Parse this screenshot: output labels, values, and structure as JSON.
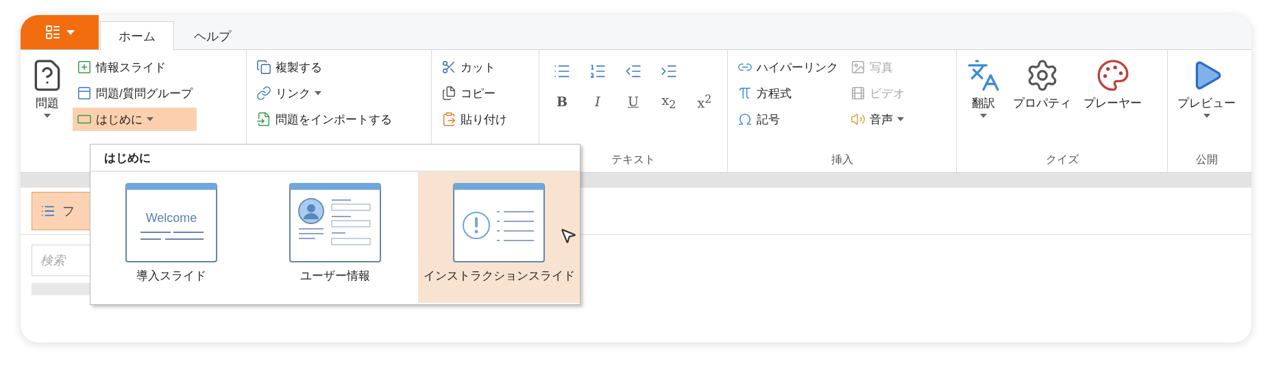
{
  "tabs": [
    {
      "label": "ホーム",
      "selected": true
    },
    {
      "label": "ヘルプ",
      "selected": false
    }
  ],
  "ribbon": {
    "groups": [
      {
        "kind": "buttons",
        "items": [
          {
            "kind": "large",
            "label": "問題",
            "dropdown": true,
            "open": false
          },
          {
            "kind": "small",
            "label": "情報スライド",
            "dropdown": false,
            "open": false
          },
          {
            "kind": "small",
            "label": "問題/質問グループ",
            "dropdown": false,
            "open": false
          },
          {
            "kind": "small",
            "label": "はじめに",
            "dropdown": true,
            "open": true
          }
        ]
      },
      {
        "kind": "buttons",
        "items": [
          {
            "kind": "small",
            "label": "複製する",
            "dropdown": false
          },
          {
            "kind": "small",
            "label": "リンク",
            "dropdown": true
          },
          {
            "kind": "small",
            "label": "問題をインポートする",
            "dropdown": false
          }
        ]
      },
      {
        "kind": "buttons",
        "items": [
          {
            "kind": "small",
            "label": "カット",
            "dropdown": false
          },
          {
            "kind": "small",
            "label": "コピー",
            "dropdown": false
          },
          {
            "kind": "small",
            "label": "貼り付け",
            "dropdown": false
          }
        ]
      },
      {
        "kind": "format",
        "label": "テキスト",
        "rows": [
          [
            {
              "kind": "icon"
            },
            {
              "kind": "icon"
            },
            {
              "kind": "icon"
            },
            {
              "kind": "icon"
            }
          ],
          [
            {
              "kind": "bold",
              "label": "B"
            },
            {
              "kind": "italic",
              "label": "I"
            },
            {
              "kind": "underline",
              "label": "U"
            },
            {
              "kind": "script",
              "label": "x$_{2}$"
            },
            {
              "kind": "script",
              "label": "x$^{2}$"
            }
          ]
        ]
      },
      {
        "kind": "buttons",
        "label": "挿入",
        "items": [
          {
            "kind": "small",
            "label": "ハイパーリンク",
            "dropdown": false,
            "disabled": false
          },
          {
            "kind": "small",
            "label": "方程式",
            "dropdown": false,
            "disabled": false
          },
          {
            "kind": "small",
            "label": "記号",
            "dropdown": false,
            "disabled": false
          },
          {
            "kind": "small",
            "label": "写真",
            "dropdown": false,
            "disabled": true
          },
          {
            "kind": "small",
            "label": "ビデオ",
            "dropdown": false,
            "disabled": true
          },
          {
            "kind": "small",
            "label": "音声",
            "dropdown": true,
            "disabled": false
          }
        ]
      },
      {
        "kind": "buttons",
        "label": "クイズ",
        "items": [
          {
            "kind": "large",
            "label": "翻訳",
            "dropdown": true
          },
          {
            "kind": "large",
            "label": "プロパティ",
            "dropdown": false
          },
          {
            "kind": "large",
            "label": "プレーヤー",
            "dropdown": false
          }
        ]
      },
      {
        "kind": "buttons",
        "label": "公開",
        "items": [
          {
            "kind": "large",
            "label": "プレビュー",
            "dropdown": true
          }
        ]
      }
    ]
  },
  "gallery": {
    "title": "はじめに",
    "items": [
      {
        "kind": "welcome",
        "text": "Welcome",
        "label": "導入スライド",
        "selected": false
      },
      {
        "kind": "profile",
        "label": "ユーザー情報",
        "selected": false
      },
      {
        "kind": "notice",
        "label": "インストラクションスライド",
        "selected": true
      }
    ]
  },
  "list": {
    "items": [
      {
        "label": "フ",
        "selected": true
      }
    ]
  },
  "search": {
    "placeholder": "検索"
  }
}
